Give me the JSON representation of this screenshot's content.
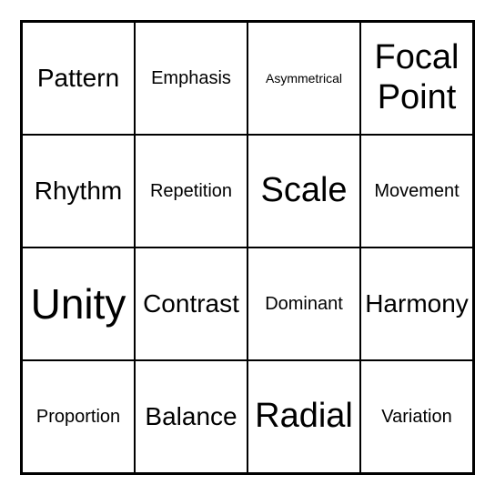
{
  "grid": {
    "cells": [
      {
        "label": "Pattern",
        "size": "size-large"
      },
      {
        "label": "Emphasis",
        "size": "size-medium"
      },
      {
        "label": "Asymmetrical",
        "size": "size-small"
      },
      {
        "label": "Focal Point",
        "size": "size-xlarge"
      },
      {
        "label": "Rhythm",
        "size": "size-large"
      },
      {
        "label": "Repetition",
        "size": "size-medium"
      },
      {
        "label": "Scale",
        "size": "size-xlarge"
      },
      {
        "label": "Movement",
        "size": "size-medium"
      },
      {
        "label": "Unity",
        "size": "size-xxlarge"
      },
      {
        "label": "Contrast",
        "size": "size-large"
      },
      {
        "label": "Dominant",
        "size": "size-medium"
      },
      {
        "label": "Harmony",
        "size": "size-large"
      },
      {
        "label": "Proportion",
        "size": "size-medium"
      },
      {
        "label": "Balance",
        "size": "size-large"
      },
      {
        "label": "Radial",
        "size": "size-xlarge"
      },
      {
        "label": "Variation",
        "size": "size-medium"
      }
    ]
  }
}
